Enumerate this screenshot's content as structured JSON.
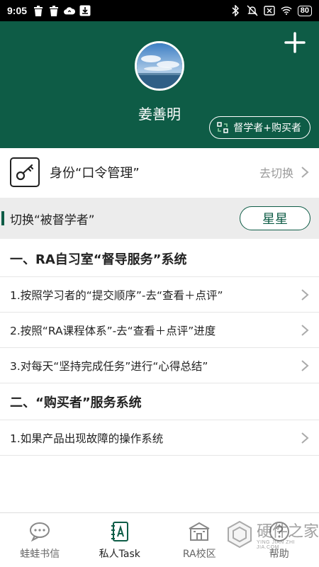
{
  "status_bar": {
    "time": "9:05",
    "battery": "80",
    "icons_left": [
      "trash-icon",
      "trash-icon",
      "cloud-icon",
      "download-icon"
    ],
    "icons_right": [
      "bluetooth-icon",
      "mute-icon",
      "sim-off-icon",
      "wifi-icon",
      "battery-icon"
    ]
  },
  "header": {
    "username": "姜善明",
    "role_button_label": "督学者+购买者",
    "background_color": "#0e5c46"
  },
  "identity": {
    "label": "身份“口令管理”",
    "action": "去切换"
  },
  "switch": {
    "label": "切换“被督学者”",
    "button_label": "星星"
  },
  "sections": [
    {
      "title": "一、RA自习室“督导服务”系统",
      "items": [
        "1.按照学习者的“提交顺序”-去“查看＋点评”",
        "2.按照“RA课程体系”-去“查看＋点评”进度",
        "3.对每天“坚持完成任务”进行“心得总结”"
      ]
    },
    {
      "title": "二、“购买者”服务系统",
      "items": [
        "1.如果产品出现故障的操作系统"
      ]
    }
  ],
  "tabbar": {
    "tabs": [
      {
        "label": "蛙蛙书信",
        "icon": "chat-icon",
        "active": false
      },
      {
        "label": "私人Task",
        "icon": "task-book-icon",
        "active": true
      },
      {
        "label": "RA校区",
        "icon": "campus-icon",
        "active": false
      },
      {
        "label": "帮助",
        "icon": "help-icon",
        "active": false
      }
    ]
  },
  "watermark": {
    "text": "硬件之家",
    "sub": "YING JIAN ZHI JIA.COM"
  }
}
